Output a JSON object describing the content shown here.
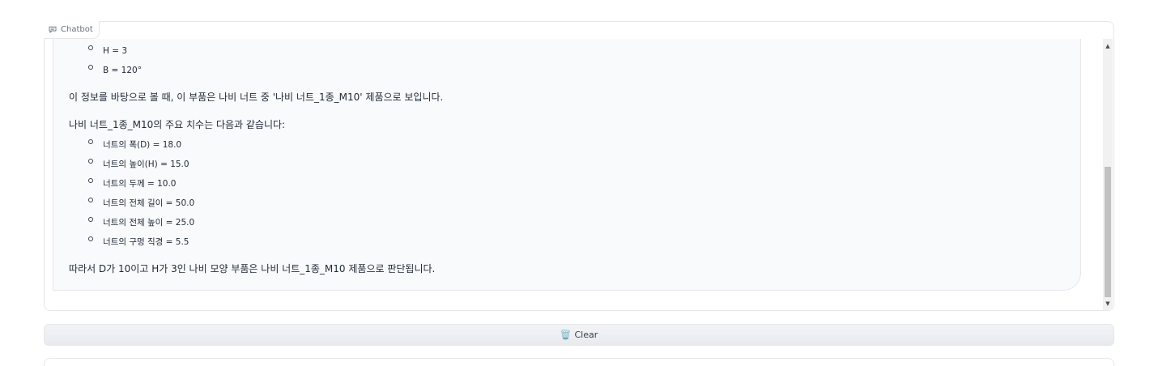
{
  "chatbot": {
    "label": "Chatbot",
    "icon": "chat-bubble-icon",
    "message": {
      "top_items": [
        "H = 3",
        "B = 120°"
      ],
      "paragraph1": "이 정보를 바탕으로 볼 때, 이 부품은 나비 너트 중 '나비 너트_1종_M10' 제품으로 보입니다.",
      "paragraph2": "나비 너트_1종_M10의 주요 치수는 다음과 같습니다:",
      "dimensions": [
        "너트의 폭(D) = 18.0",
        "너트의 높이(H) = 15.0",
        "너트의 두께 = 10.0",
        "너트의 전체 길이 = 50.0",
        "너트의 전체 높이 = 25.0",
        "너트의 구멍 직경 = 5.5"
      ],
      "conclusion": "따라서 D가 10이고 H가 3인 나비 모양 부품은 나비 너트_1종_M10 제품으로 판단됩니다."
    }
  },
  "clear_button": {
    "label": "Clear",
    "icon": "wastebasket-icon",
    "glyph": "🗑️"
  },
  "scrollbar": {
    "up": "▲",
    "down": "▼"
  }
}
